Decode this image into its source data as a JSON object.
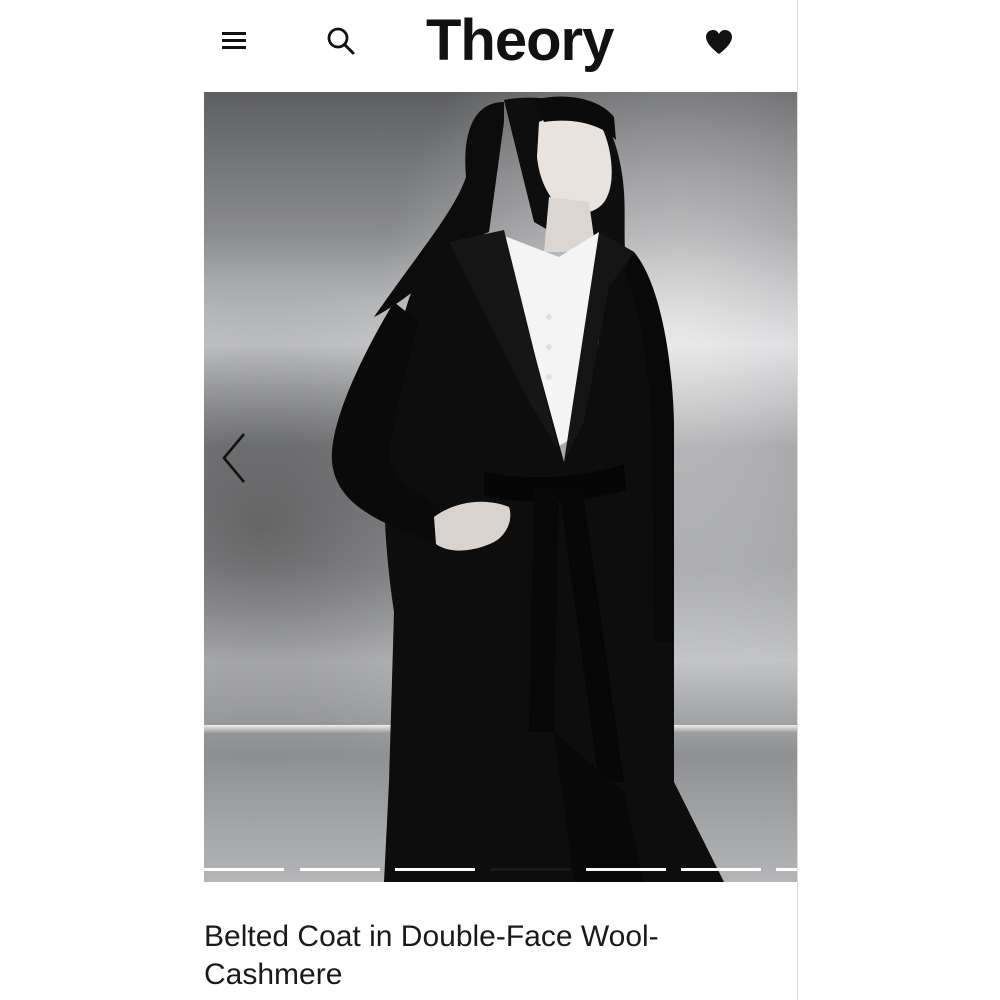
{
  "header": {
    "menu_icon": "hamburger-menu-icon",
    "search_icon": "search-icon",
    "logo_text": "Theory",
    "favorites_icon": "heart-icon"
  },
  "hero": {
    "prev_icon": "chevron-left-icon",
    "slide_count": 7,
    "active_slide": 4
  },
  "product": {
    "title_line1": "Belted Coat in Double-Face Wool-",
    "title_line2": "Cashmere"
  },
  "colors": {
    "text": "#1a1a1a",
    "indicator_inactive": "#ffffff",
    "indicator_active": "#1b1b1b"
  }
}
